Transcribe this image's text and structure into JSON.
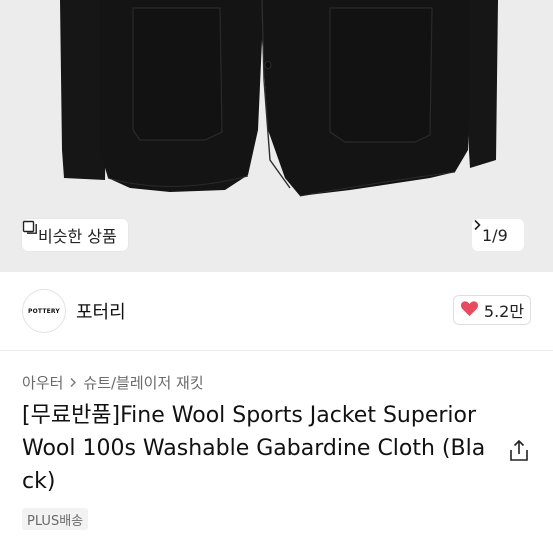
{
  "product_gallery": {
    "similar_button_label": "비슷한 상품",
    "image_counter": "1/9"
  },
  "brand": {
    "logo_text": "POTTERY",
    "name": "포터리",
    "like_count": "5.2만"
  },
  "breadcrumb": {
    "category": "아우터",
    "subcategory": "슈트/블레이저 재킷"
  },
  "product": {
    "title": "[무료반품]Fine Wool Sports Jacket Superior Wool 100s Washable Gabardine Cloth (Black)",
    "shipping_tag": "PLUS배송"
  },
  "colors": {
    "heart": "#e84a5f",
    "hero_background": "#ececec",
    "jacket": "#151515"
  },
  "icons": {
    "similar": "similar-products-icon",
    "counter": "chevron-right-icon",
    "like": "heart-icon",
    "breadcrumb_separator": "chevron-right-icon",
    "share": "share-icon"
  }
}
